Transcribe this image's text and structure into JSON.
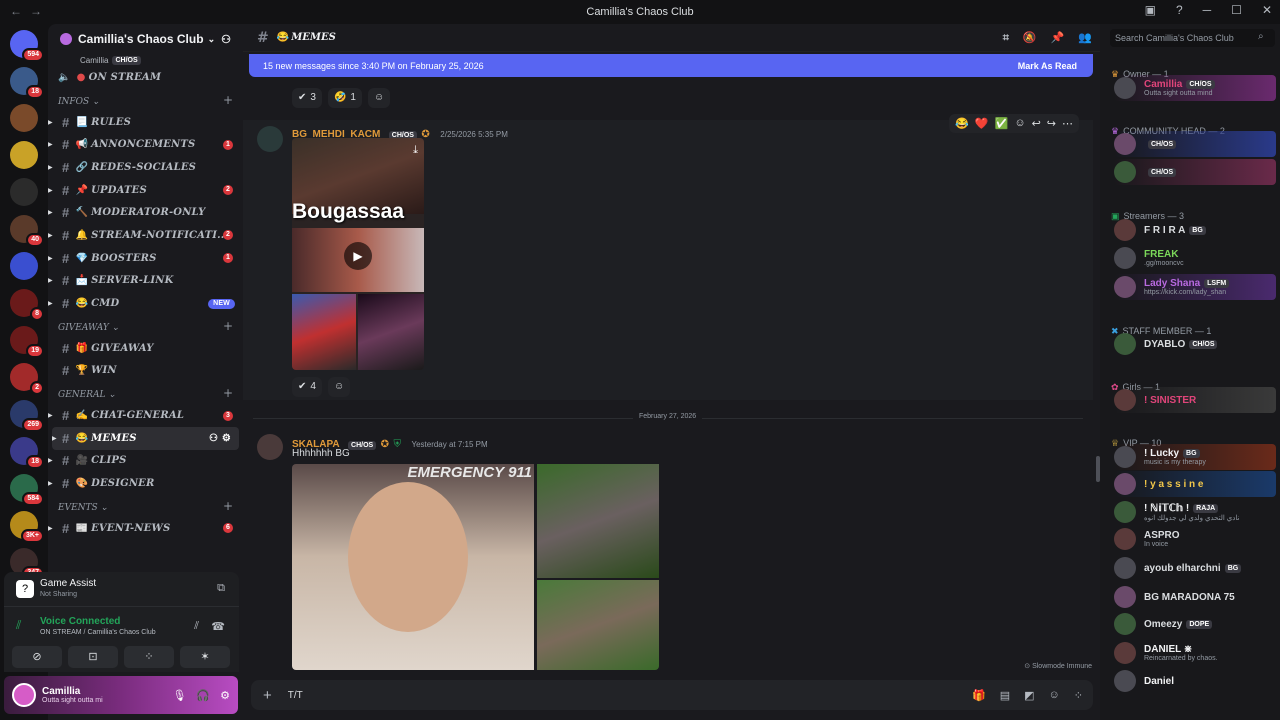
{
  "window": {
    "title": "Camillia's Chaos Club"
  },
  "servers": [
    {
      "color": "#5865f2",
      "badge": "594"
    },
    {
      "color": "#3a5a8a",
      "badge": "18"
    },
    {
      "color": "#7a4a2a",
      "badge": ""
    },
    {
      "color": "#c9a227",
      "badge": ""
    },
    {
      "color": "#2b2b2b",
      "badge": ""
    },
    {
      "color": "#5a3a2a",
      "badge": "40"
    },
    {
      "color": "#3a4fd0",
      "badge": ""
    },
    {
      "color": "#6a1a1a",
      "badge": "8"
    },
    {
      "color": "#6a1a1a",
      "badge": "19"
    },
    {
      "color": "#a22a2a",
      "badge": "2"
    },
    {
      "color": "#2a3a6a",
      "badge": "269"
    },
    {
      "color": "#3a3a8a",
      "badge": "18"
    },
    {
      "color": "#2a6a4a",
      "badge": "584"
    },
    {
      "color": "#b58a1a",
      "badge": "3K+"
    },
    {
      "color": "#3a2a2a",
      "badge": "347"
    },
    {
      "color": "#6a5a3a",
      "badge": ""
    }
  ],
  "sidebar": {
    "server_name": "Camillia's Chaos Club",
    "voice_user": "Camillia",
    "voice_user_tag": "CH/OS",
    "on_stream": "ON STREAM",
    "categories": {
      "infos": "INFOS",
      "giveaway": "GIVEAWAY",
      "general": "GENERAL",
      "events": "EVENTS"
    },
    "infos_channels": [
      {
        "icon": "📃",
        "label": "RULES",
        "count": ""
      },
      {
        "icon": "📢",
        "label": "ANNONCEMENTS",
        "count": "1"
      },
      {
        "icon": "🔗",
        "label": "REDES-SOCIALES",
        "count": ""
      },
      {
        "icon": "📌",
        "label": "UPDATES",
        "count": "2"
      },
      {
        "icon": "🔨",
        "label": "MODERATOR-ONLY",
        "count": ""
      },
      {
        "icon": "🔔",
        "label": "STREAM-NOTIFICATI...",
        "count": "2"
      },
      {
        "icon": "💎",
        "label": "BOOSTERS",
        "count": "1"
      },
      {
        "icon": "📩",
        "label": "SERVER-LINK",
        "count": ""
      },
      {
        "icon": "😂",
        "label": "CMD",
        "count": "",
        "new": "NEW"
      }
    ],
    "giveaway_channels": [
      {
        "icon": "🎁",
        "label": "GIVEAWAY"
      },
      {
        "icon": "🏆",
        "label": "WIN"
      }
    ],
    "general_channels": [
      {
        "icon": "✍",
        "label": "CHAT-GENERAL",
        "count": "3"
      },
      {
        "icon": "😂",
        "label": "MEMES",
        "count": ""
      },
      {
        "icon": "🎥",
        "label": "CLIPS",
        "count": ""
      },
      {
        "icon": "🎨",
        "label": "DESIGNER",
        "count": ""
      }
    ],
    "events_channels": [
      {
        "icon": "📰",
        "label": "EVENT-NEWS",
        "count": "6"
      }
    ],
    "game_assist": {
      "title": "Game Assist",
      "status": "Not Sharing"
    },
    "voice": {
      "title": "Voice Connected",
      "location": "ON STREAM / Camillia's Chaos Club"
    },
    "user": {
      "name": "Camillia",
      "status": "Outta sight outta mi"
    }
  },
  "channel": {
    "name": "MEMES",
    "icon": "😂"
  },
  "banner": {
    "text": "15 new messages since 3:40 PM on February 25, 2026",
    "action": "Mark As Read"
  },
  "top_reactions": [
    {
      "emoji": "✔",
      "count": "3"
    },
    {
      "emoji": "🤣",
      "count": "1"
    }
  ],
  "messages": [
    {
      "author": "BG_MEHDI_KACM",
      "tag": "CH/OS",
      "time": "2/25/2026 5:35 PM",
      "author_color": "#e09a3a",
      "video_caption": "Bougassaa",
      "reactions": [
        {
          "emoji": "✔",
          "count": "4"
        }
      ]
    },
    {
      "author": "SKALAPA",
      "tag": "CH/OS",
      "time": "Yesterday at 7:15 PM",
      "author_color": "#e09a3a",
      "text": "Hhhhhhh BG",
      "image_text": "EMERGENCY 911"
    }
  ],
  "date_divider": "February 27, 2026",
  "slowmode": "Slowmode Immune",
  "composer": {
    "value": "T/T"
  },
  "search": {
    "placeholder": "Search Camillia's Chaos Club"
  },
  "members": {
    "owner_header": "Owner — 1",
    "community_head_header": "COMMUNITY HEAD — 2",
    "streamers_header": "Streamers — 3",
    "staff_header": "STAFF MEMBER — 1",
    "girls_header": "Girls — 1",
    "vip_header": "VIP — 10",
    "list": [
      {
        "name": "Camillia",
        "tag": "CH/OS",
        "sub": "Outta sight outta mind",
        "color": "#e0457a",
        "bg": "#6a2a6e",
        "group": "owner"
      },
      {
        "name": "",
        "tag": "CH/OS",
        "sub": "",
        "color": "#dbdee1",
        "bg": "#2a3a8a",
        "group": "ch1"
      },
      {
        "name": "",
        "tag": "CH/OS",
        "sub": "",
        "color": "#e04a4a",
        "bg": "#6a2a4a",
        "group": "ch2"
      },
      {
        "name": "F R I R A",
        "tag": "BG",
        "sub": "",
        "color": "#dbdee1",
        "bg": "",
        "group": "s1"
      },
      {
        "name": "FREAK",
        "tag": "",
        "sub": ".gg/mooncvc",
        "color": "#7bd85a",
        "bg": "",
        "group": "s2"
      },
      {
        "name": "Lady Shana",
        "tag": "LSFM",
        "sub": "https://kick.com/lady_shan",
        "color": "#b86ae0",
        "bg": "#4a2a6e",
        "group": "s3"
      },
      {
        "name": "DYABLO",
        "tag": "CH/OS",
        "sub": "",
        "color": "#dbdee1",
        "bg": "",
        "group": "staff"
      },
      {
        "name": "! SINISTER",
        "tag": "",
        "sub": "",
        "color": "#e0457a",
        "bg": "#3a3a3a",
        "group": "girl"
      },
      {
        "name": "! Lucky",
        "tag": "BG",
        "sub": "music is my therapy",
        "color": "#f2f3f5",
        "bg": "#6a2a1a",
        "group": "v1"
      },
      {
        "name": "! y a s s i n e",
        "tag": "",
        "sub": "",
        "color": "#f2c84a",
        "bg": "#1a3a6a",
        "group": "v2"
      },
      {
        "name": "! ℕ𝕚𝕋ℂ𝕙 !",
        "tag": "RAJA",
        "sub": "نادي التحدي ولدي لي جدولك انوه",
        "color": "#f2f3f5",
        "bg": "",
        "group": "v3"
      },
      {
        "name": "ASPRO",
        "tag": "",
        "sub": "In voice",
        "color": "#dbdee1",
        "bg": "",
        "group": "v4"
      },
      {
        "name": "ayoub elharchni",
        "tag": "BG",
        "sub": "",
        "color": "#dbdee1",
        "bg": "",
        "group": "v5"
      },
      {
        "name": "BG MARADONA 75",
        "tag": "",
        "sub": "",
        "color": "#dbdee1",
        "bg": "",
        "group": "v6"
      },
      {
        "name": "Omeezy",
        "tag": "DOPE",
        "sub": "",
        "color": "#dbdee1",
        "bg": "",
        "group": "v7"
      },
      {
        "name": "DANIEL ⋇",
        "tag": "",
        "sub": "Reincarnated by chaos.",
        "color": "#f2f3f5",
        "bg": "",
        "group": "v8"
      },
      {
        "name": "Daniel",
        "tag": "",
        "sub": "",
        "color": "#f2f3f5",
        "bg": "",
        "group": "v9"
      }
    ]
  }
}
